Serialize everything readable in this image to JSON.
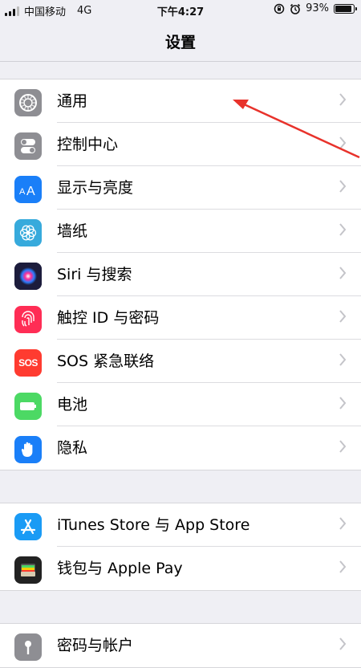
{
  "status_bar": {
    "carrier": "中国移动",
    "network": "4G",
    "time": "下午4:27",
    "battery_text": "93%",
    "battery_level": 0.93
  },
  "nav": {
    "title": "设置"
  },
  "groups": [
    {
      "items": [
        {
          "label": "通用",
          "icon": "gear-icon",
          "color": "#8e8e93"
        },
        {
          "label": "控制中心",
          "icon": "toggles-icon",
          "color": "#8e8e93"
        },
        {
          "label": "显示与亮度",
          "icon": "text-size-icon",
          "color": "#1a7ff8"
        },
        {
          "label": "墙纸",
          "icon": "flower-icon",
          "color": "#37aadc"
        },
        {
          "label": "Siri 与搜索",
          "icon": "siri-icon",
          "color": "#1c1c3c"
        },
        {
          "label": "触控 ID 与密码",
          "icon": "fingerprint-icon",
          "color": "#ff2d55"
        },
        {
          "label": "SOS 紧急联络",
          "icon": "sos-icon",
          "color": "#ff3b30",
          "icon_text": "SOS"
        },
        {
          "label": "电池",
          "icon": "battery-icon",
          "color": "#4cd964"
        },
        {
          "label": "隐私",
          "icon": "hand-icon",
          "color": "#1a7ff8"
        }
      ]
    },
    {
      "items": [
        {
          "label": "iTunes Store 与 App Store",
          "icon": "app-store-icon",
          "color": "#1a9bf5"
        },
        {
          "label": "钱包与 Apple Pay",
          "icon": "wallet-icon",
          "color": "#222222"
        }
      ]
    },
    {
      "items": [
        {
          "label": "密码与帐户",
          "icon": "key-icon",
          "color": "#8e8e93"
        }
      ]
    }
  ],
  "annotation": {
    "arrow_color": "#e8322b"
  }
}
